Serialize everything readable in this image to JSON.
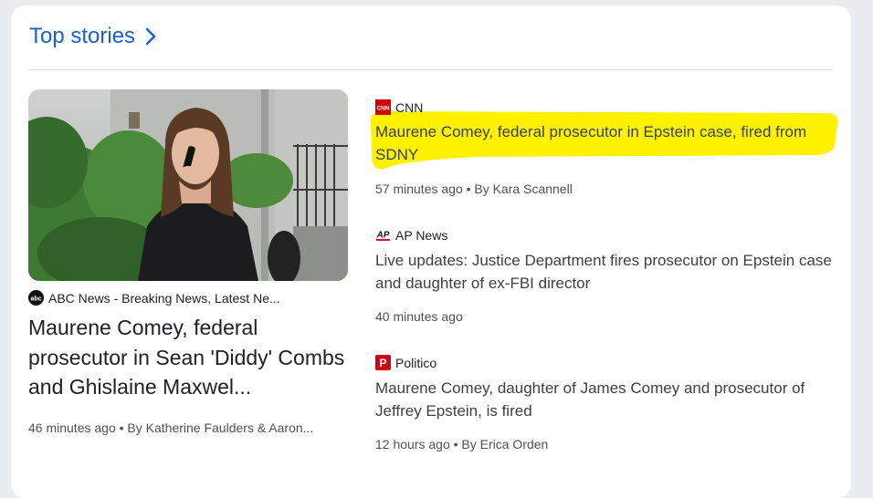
{
  "section": {
    "title": "Top stories"
  },
  "lead_story": {
    "source": "ABC News - Breaking News, Latest Ne...",
    "headline": "Maurene Comey, federal prosecutor in Sean 'Diddy' Combs and Ghislaine Maxwel...",
    "time": "46 minutes ago",
    "byline": "By Katherine Faulders & Aaron..."
  },
  "stories": [
    {
      "source": "CNN",
      "logo_text": "CNN",
      "headline_line1": "Maurene Comey, federal prosecutor in Epstein case, fired from",
      "headline_line2": "SDNY",
      "time": "57 minutes ago",
      "byline": "By Kara Scannell"
    },
    {
      "source": "AP News",
      "logo_text": "AP",
      "headline": "Live updates: Justice Department fires prosecutor on Epstein case and daughter of ex-FBI director",
      "time": "40 minutes ago"
    },
    {
      "source": "Politico",
      "logo_text": "P",
      "headline": "Maurene Comey, daughter of James Comey and prosecutor of Jeffrey Epstein, is fired",
      "time": "12 hours ago",
      "byline": "By Erica Orden"
    }
  ],
  "colors": {
    "link_blue": "#1a5fd0",
    "highlight": "#fff200",
    "cnn_red": "#cc0000",
    "politico_red": "#d0021b"
  },
  "separator": "•"
}
